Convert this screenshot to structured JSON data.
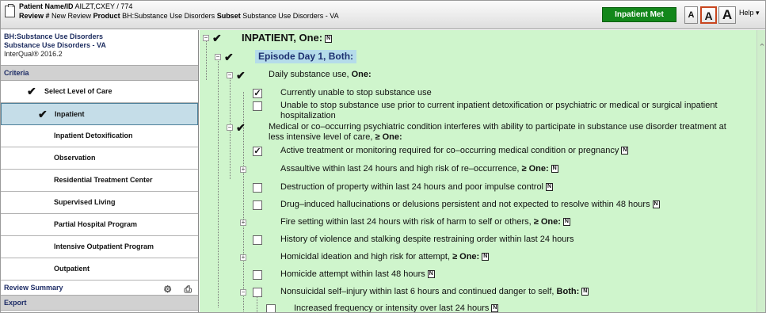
{
  "header": {
    "patient_label": "Patient Name/ID",
    "patient_value": "AILZT,CXEY / 774",
    "review_label": "Review #",
    "review_value": "New Review",
    "product_label": "Product",
    "product_value": "BH:Substance Use Disorders",
    "subset_label": "Subset",
    "subset_value": "Substance Use Disorders - VA",
    "status_button": "Inpatient Met",
    "font_small": "A",
    "font_medium": "A",
    "font_large": "A",
    "help_label": "Help ▾"
  },
  "sidebar": {
    "product_title": "BH:Substance Use Disorders",
    "subset_title": "Substance Use Disorders - VA",
    "version": "InterQual® 2016.2",
    "criteria_header": "Criteria",
    "items": [
      {
        "label": "Select Level of Care",
        "checked": true,
        "level": 1
      },
      {
        "label": "Inpatient",
        "checked": true,
        "level": 2,
        "selected": true
      },
      {
        "label": "Inpatient Detoxification",
        "checked": false,
        "level": 2
      },
      {
        "label": "Observation",
        "checked": false,
        "level": 2
      },
      {
        "label": "Residential Treatment Center",
        "checked": false,
        "level": 2
      },
      {
        "label": "Supervised Living",
        "checked": false,
        "level": 2
      },
      {
        "label": "Partial Hospital Program",
        "checked": false,
        "level": 2
      },
      {
        "label": "Intensive Outpatient Program",
        "checked": false,
        "level": 2
      },
      {
        "label": "Outpatient",
        "checked": false,
        "level": 2
      }
    ],
    "review_summary": "Review Summary",
    "export": "Export"
  },
  "criteria": {
    "rows": [
      {
        "text": "INPATIENT",
        "suffix": ", One:",
        "checked": true,
        "note": "N"
      },
      {
        "text": "Episode Day 1, Both:",
        "checked": true
      },
      {
        "text": "Daily substance use, ",
        "suffix": "One:",
        "checked": true
      },
      {
        "text": "Currently unable to stop substance use",
        "checked": true
      },
      {
        "text": "Unable to stop substance use prior to current inpatient detoxification or psychiatric or medical or surgical inpatient",
        "text2": "hospitalization",
        "checked": false
      },
      {
        "text": "Medical or co–occurring psychiatric condition interferes with ability to participate in substance use disorder treatment at",
        "text2": "less intensive level of care, ",
        "suffix2": "≥ One:",
        "checked": true
      },
      {
        "text": "Active treatment or monitoring required for co–occurring medical condition or pregnancy",
        "checked": true,
        "note": "N"
      },
      {
        "text": "Assaultive within last 24 hours and high risk of re–occurrence, ",
        "suffix": "≥ One:",
        "checked": false,
        "note": "N"
      },
      {
        "text": "Destruction of property within last 24 hours and poor impulse control",
        "checked": false,
        "note": "N"
      },
      {
        "text": "Drug–induced hallucinations or delusions persistent and not expected to resolve within 48 hours",
        "checked": false,
        "note": "N"
      },
      {
        "text": "Fire setting within last 24 hours with risk of harm to self or others, ",
        "suffix": "≥ One:",
        "checked": false,
        "note": "N"
      },
      {
        "text": "History of violence and stalking despite restraining order within last 24 hours",
        "checked": false
      },
      {
        "text": "Homicidal ideation and high risk for attempt, ",
        "suffix": "≥ One:",
        "checked": false,
        "note": "N"
      },
      {
        "text": "Homicide attempt within last 48 hours",
        "checked": false,
        "note": "N"
      },
      {
        "text": "Nonsuicidal self–injury within last 6 hours and continued danger to self, ",
        "suffix": "Both:",
        "checked": false,
        "note": "N"
      },
      {
        "text": "Increased frequency or intensity over last 24 hours",
        "checked": false,
        "note": "N"
      }
    ]
  },
  "icons": {
    "check": "✔",
    "check_mark": "✓",
    "note": "N",
    "minus": "−",
    "plus": "+",
    "scroll_up": "⌃",
    "settings": "⚙",
    "print": "⎙"
  },
  "colors": {
    "status_green": "#13871b",
    "criteria_bg": "#cff5cc",
    "episode_highlight": "#b5dcea",
    "selected_bg": "#c5dde8"
  }
}
